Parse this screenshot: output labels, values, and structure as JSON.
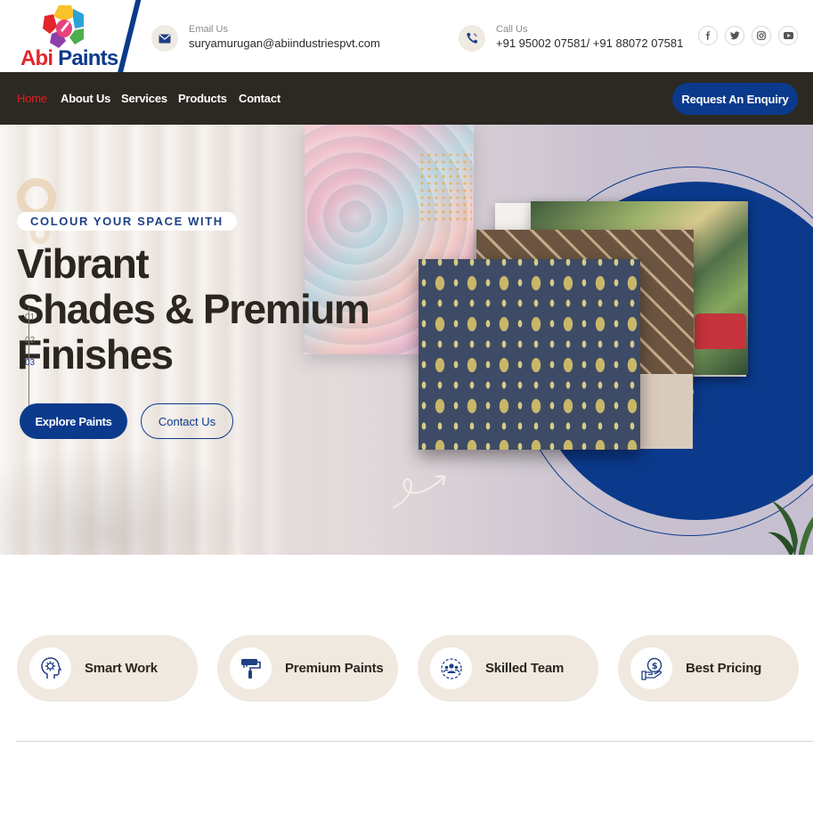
{
  "brand": {
    "name_part1": "Abi",
    "name_part2": "Paints"
  },
  "contact": {
    "email_label": "Email Us",
    "email_value": "suryamurugan@abiindustriespvt.com",
    "phone_label": "Call Us",
    "phone_value": "+91 95002 07581/ +91 88072 07581"
  },
  "social": [
    "facebook-icon",
    "twitter-icon",
    "instagram-icon",
    "youtube-icon"
  ],
  "nav": {
    "items": [
      {
        "label": "Home",
        "active": true
      },
      {
        "label": "About Us",
        "active": false
      },
      {
        "label": "Services",
        "active": false
      },
      {
        "label": "Products",
        "active": false
      },
      {
        "label": "Contact",
        "active": false
      }
    ],
    "cta_label": "Request An Enquiry"
  },
  "hero": {
    "tagline": "COLOUR YOUR SPACE WITH",
    "headline_line1": "Vibrant",
    "headline_line2": "Shades & Premium",
    "headline_line3": "Finishes",
    "slides": [
      "01",
      "02",
      "03"
    ],
    "active_slide": "03",
    "primary_button": "Explore Paints",
    "secondary_button": "Contact Us"
  },
  "features": [
    {
      "label": "Smart Work",
      "icon": "brain-gear-icon"
    },
    {
      "label": "Premium Paints",
      "icon": "paint-roller-icon"
    },
    {
      "label": "Skilled Team",
      "icon": "team-icon"
    },
    {
      "label": "Best Pricing",
      "icon": "dollar-hand-icon"
    }
  ],
  "colors": {
    "brand_blue": "#0b3a8c",
    "brand_red": "#e3262b",
    "nav_background": "#2c2922",
    "active_nav": "#e02020",
    "feature_background": "#f0e9df"
  }
}
